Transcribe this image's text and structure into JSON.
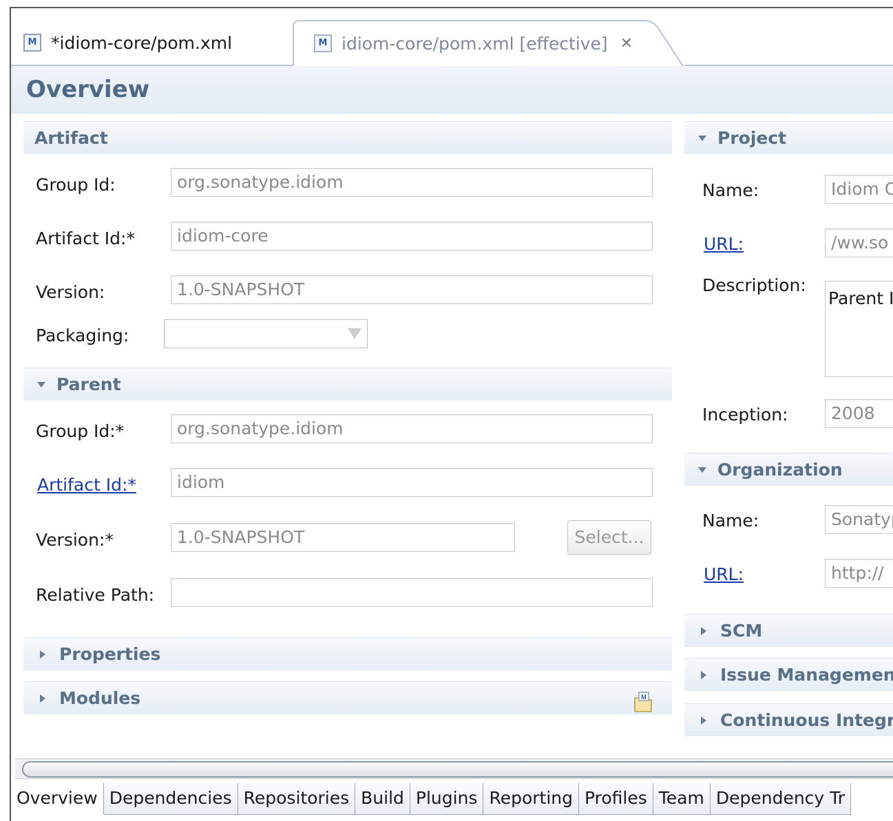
{
  "editor_tabs": [
    {
      "label": "*idiom-core/pom.xml",
      "icon": "maven-pom-icon",
      "active": true
    },
    {
      "label": "idiom-core/pom.xml [effective]",
      "icon": "maven-pom-icon",
      "active": false
    }
  ],
  "page_title": "Overview",
  "artifact": {
    "title": "Artifact",
    "group_id_label": "Group Id:",
    "group_id_value": "org.sonatype.idiom",
    "artifact_id_label": "Artifact Id:*",
    "artifact_id_value": "idiom-core",
    "version_label": "Version:",
    "version_value": "1.0-SNAPSHOT",
    "packaging_label": "Packaging:",
    "packaging_value": ""
  },
  "parent": {
    "title": "Parent",
    "group_id_label": "Group Id:*",
    "group_id_value": "org.sonatype.idiom",
    "artifact_id_label": "Artifact Id:*",
    "artifact_id_value": "idiom",
    "version_label": "Version:*",
    "version_value": "1.0-SNAPSHOT",
    "select_label": "Select...",
    "relative_path_label": "Relative Path:",
    "relative_path_value": ""
  },
  "collapsed_left": {
    "properties": "Properties",
    "modules": "Modules"
  },
  "project": {
    "title": "Project",
    "name_label": "Name:",
    "name_value": "Idiom C",
    "url_label": "URL:",
    "url_value": "/ww.so",
    "description_label": "Description:",
    "description_value": "Parent I",
    "inception_label": "Inception:",
    "inception_value": "2008"
  },
  "organization": {
    "title": "Organization",
    "name_label": "Name:",
    "name_value": "Sonatyp",
    "url_label": "URL:",
    "url_value": "http://"
  },
  "collapsed_right": {
    "scm": "SCM",
    "issue_management": "Issue Management",
    "ci": "Continuous Integra"
  },
  "bottom_tabs": [
    "Overview",
    "Dependencies",
    "Repositories",
    "Build",
    "Plugins",
    "Reporting",
    "Profiles",
    "Team",
    "Dependency Tr"
  ]
}
